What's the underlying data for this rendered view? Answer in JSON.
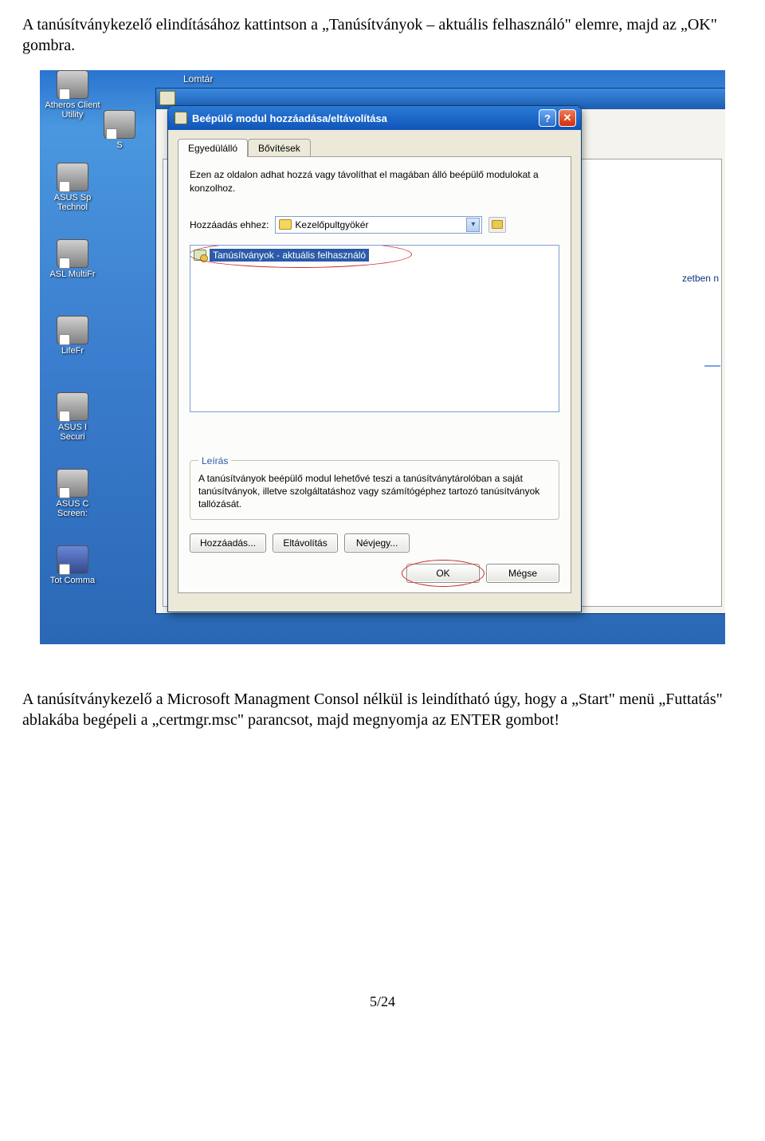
{
  "doc": {
    "para1": "A tanúsítványkezelő elindításához kattintson a „Tanúsítványok – aktuális felhasználó\" elemre, majd az „OK\" gombra.",
    "para2": "A tanúsítványkezelő a Microsoft Managment Consol nélkül is leindítható úgy, hogy a „Start\" menü „Futtatás\" ablakába begépeli a „certmgr.msc\" parancsot, majd megnyomja az ENTER gombot!",
    "pagenum": "5/24"
  },
  "desktop": {
    "icons": [
      {
        "label": "Atheros Client Utility"
      },
      {
        "label": "S"
      },
      {
        "label": "ASUS Sp Technol"
      },
      {
        "label": "ASL MultiFr"
      },
      {
        "label": "LifeFr"
      },
      {
        "label": "ASUS I Securi"
      },
      {
        "label": "ASUS C Screen:"
      },
      {
        "label": "Tot Comma"
      }
    ],
    "lomtar": "Lomtár"
  },
  "snaptext": "zetben n",
  "dialog": {
    "title": "Beépülő modul hozzáadása/eltávolítása",
    "help": "?",
    "close": "✕",
    "tabs": {
      "standalone": "Egyedülálló",
      "extensions": "Bővítések"
    },
    "info": "Ezen az oldalon adhat hozzá vagy távolíthat el magában álló beépülő modulokat a konzolhoz.",
    "addto_label": "Hozzáadás ehhez:",
    "addto_value": "Kezelőpultgyökér",
    "list_item": "Tanúsítványok - aktuális felhasználó",
    "desc_legend": "Leírás",
    "desc_text": "A tanúsítványok beépülő modul lehetővé teszi a tanúsítványtárolóban a saját tanúsítványok, illetve szolgáltatáshoz vagy számítógéphez tartozó tanúsítványok tallózását.",
    "buttons": {
      "add": "Hozzáadás...",
      "remove": "Eltávolítás",
      "about": "Névjegy...",
      "ok": "OK",
      "cancel": "Mégse"
    }
  }
}
